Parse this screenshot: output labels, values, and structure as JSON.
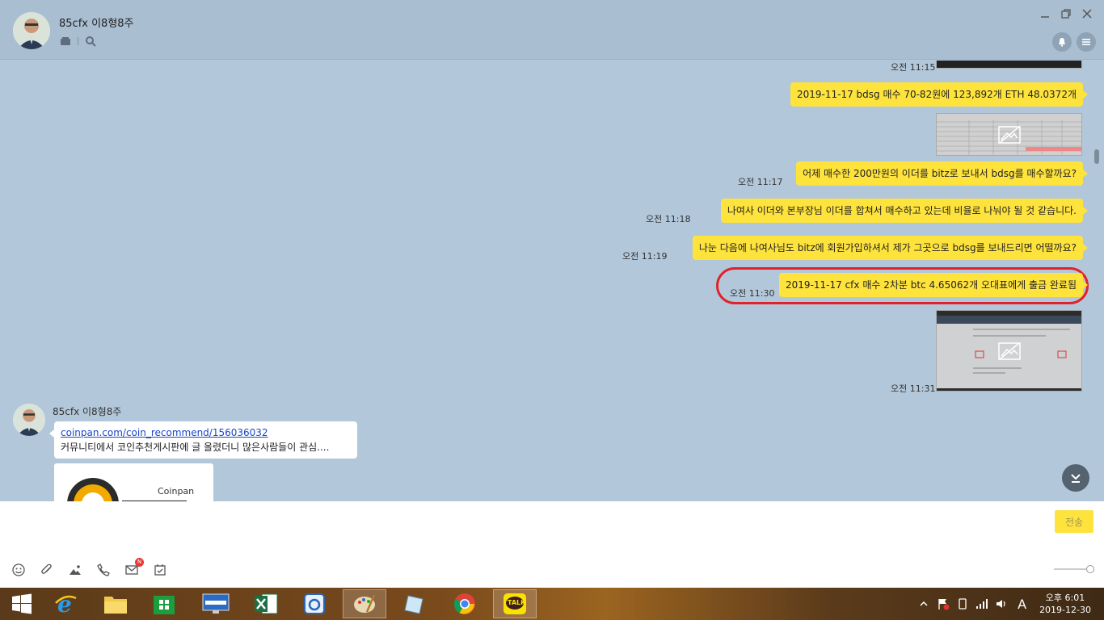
{
  "header": {
    "title": "85cfx 이8형8주"
  },
  "messages": [
    {
      "kind": "time",
      "time": "오전 11:15"
    },
    {
      "kind": "text",
      "text": "2019-11-17 bdsg 매수 70-82원에 123,892개 ETH 48.0372개"
    },
    {
      "kind": "image"
    },
    {
      "kind": "text",
      "time": "오전 11:17",
      "text": "어제 매수한 200만원의 이더를 bitz로 보내서 bdsg를 매수할까요?"
    },
    {
      "kind": "text",
      "time": "오전 11:18",
      "text": "나여사 이더와 본부장님 이더를 합쳐서 매수하고 있는데 비율로 나눠야 될 것 같습니다."
    },
    {
      "kind": "text",
      "time": "오전 11:19",
      "text": "나눈 다음에 나여사님도 bitz에 회원가입하셔서 제가 그곳으로 bdsg를 보내드리면 어떨까요?"
    },
    {
      "kind": "text",
      "time": "오전 11:30",
      "text": "2019-11-17 cfx 매수 2차분 btc 4.65062개 오대표에게 출금 완료됨",
      "highlighted": true
    },
    {
      "kind": "image",
      "time": "오전 11:31"
    }
  ],
  "incoming": {
    "sender": "85cfx 이8형8주",
    "link": "coinpan.com/coin_recommend/156036032",
    "preview": "커뮤니티에서 코인추천게시판에 글 올렸더니 많은사람들이 관심....",
    "card_brand": "Coinpan"
  },
  "input": {
    "send_label": "전송"
  },
  "taskbar": {
    "apps": [
      "windows-start",
      "internet-explorer",
      "file-explorer",
      "windows-store",
      "lenovo",
      "excel",
      "hangul",
      "paint",
      "notes",
      "chrome",
      "kakaotalk"
    ],
    "kakao_label": "TALK",
    "ime": "A",
    "clock_time": "오후 6:01",
    "clock_date": "2019-12-30"
  },
  "colors": {
    "chat_bg": "#b2c7da",
    "my_bubble": "#fee33c",
    "highlight": "#e2222a"
  }
}
